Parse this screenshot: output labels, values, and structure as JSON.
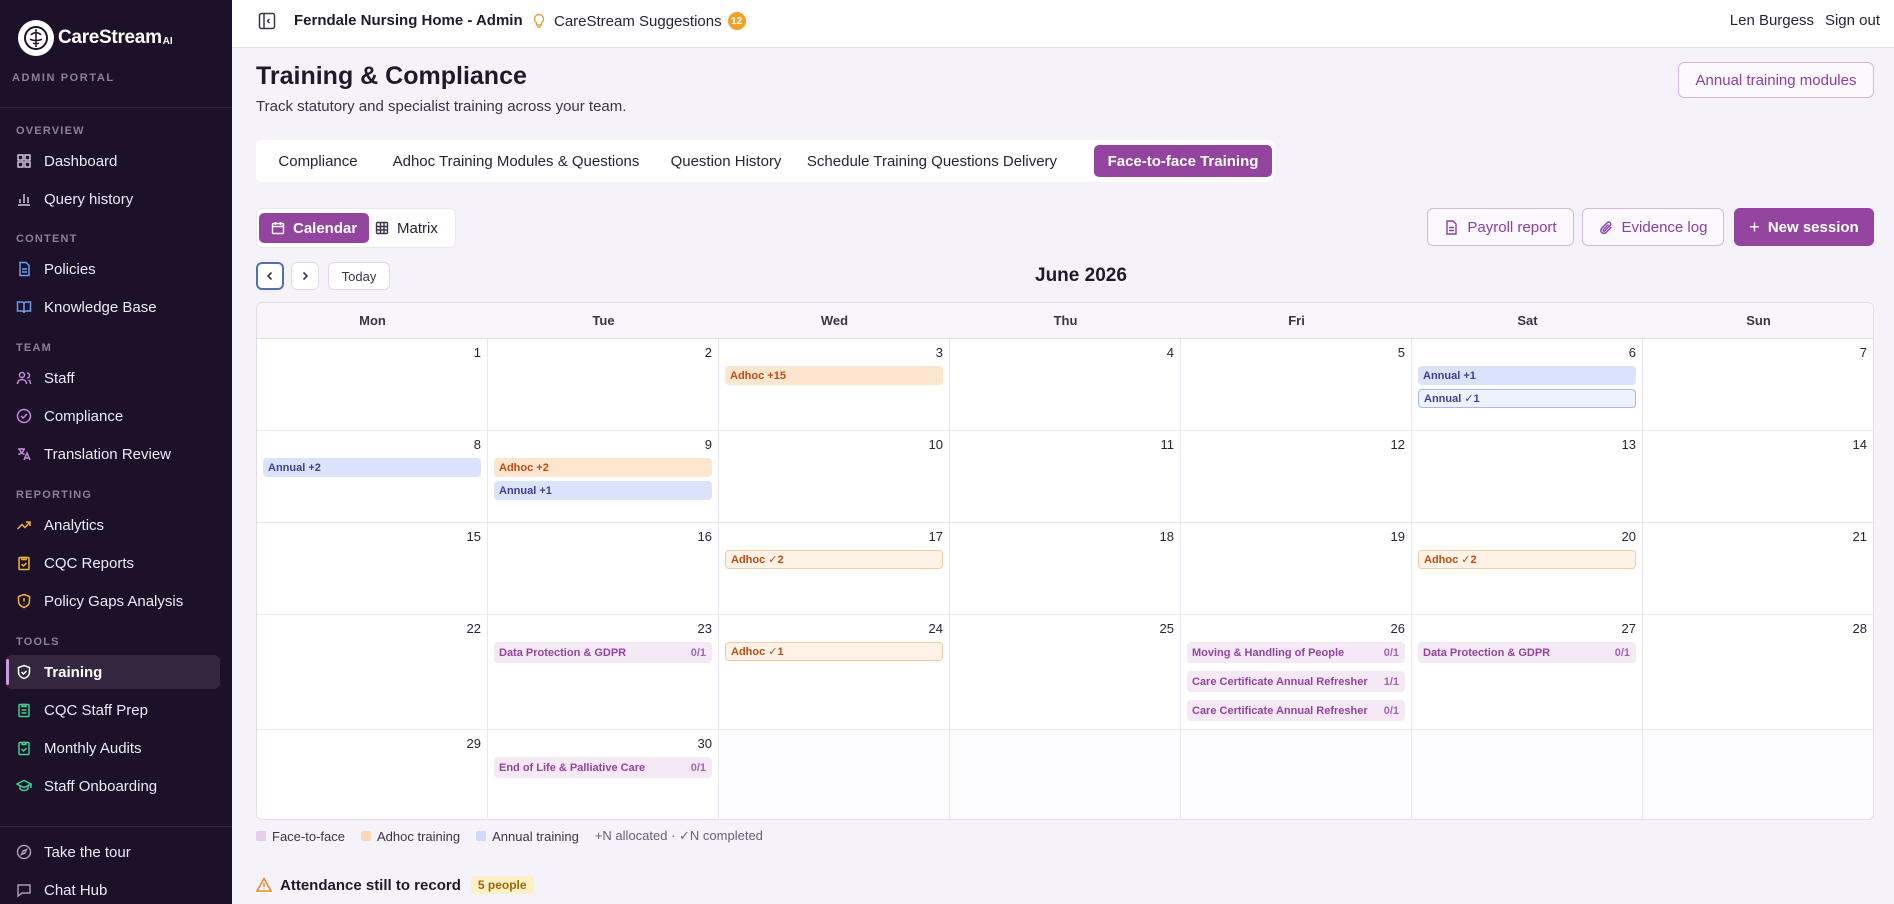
{
  "sidebar": {
    "brand": "CareStream",
    "brand_suffix": "AI",
    "portal_label": "ADMIN PORTAL",
    "sections": {
      "overview": "OVERVIEW",
      "content": "CONTENT",
      "team": "TEAM",
      "reporting": "REPORTING",
      "tools": "TOOLS"
    },
    "items": {
      "dashboard": "Dashboard",
      "query_history": "Query history",
      "policies": "Policies",
      "knowledge_base": "Knowledge Base",
      "staff": "Staff",
      "compliance": "Compliance",
      "translation_review": "Translation Review",
      "analytics": "Analytics",
      "cqc_reports": "CQC Reports",
      "policy_gaps": "Policy Gaps Analysis",
      "training": "Training",
      "cqc_staff_prep": "CQC Staff Prep",
      "monthly_audits": "Monthly Audits",
      "staff_onboarding": "Staff Onboarding",
      "take_tour": "Take the tour",
      "chat_hub": "Chat Hub"
    },
    "active_item": "training"
  },
  "topbar": {
    "org_title": "Ferndale Nursing Home - Admin",
    "suggestions_label": "CareStream Suggestions",
    "suggestions_count": "12",
    "user_name": "Len Burgess",
    "signout_label": "Sign out"
  },
  "page": {
    "title": "Training & Compliance",
    "subtitle": "Track statutory and specialist training across your team.",
    "annual_modules_button": "Annual training modules"
  },
  "tabs": [
    {
      "label": "Compliance",
      "active": false
    },
    {
      "label": "Adhoc Training Modules & Questions",
      "active": false
    },
    {
      "label": "Question History",
      "active": false
    },
    {
      "label": "Schedule Training Questions Delivery",
      "active": false
    },
    {
      "label": "Face-to-face Training",
      "active": true
    }
  ],
  "view_toggle": {
    "calendar": "Calendar",
    "matrix": "Matrix",
    "active": "calendar"
  },
  "actions": {
    "payroll": "Payroll report",
    "evidence": "Evidence log",
    "new_session": "New session"
  },
  "calendar": {
    "today_label": "Today",
    "month_title": "June 2026",
    "weekdays": [
      "Mon",
      "Tue",
      "Wed",
      "Thu",
      "Fri",
      "Sat",
      "Sun"
    ],
    "weeks": [
      [
        {
          "day": "1",
          "events": []
        },
        {
          "day": "2",
          "events": []
        },
        {
          "day": "3",
          "events": [
            {
              "type": "adhoc",
              "label": "Adhoc +15"
            }
          ]
        },
        {
          "day": "4",
          "events": []
        },
        {
          "day": "5",
          "events": []
        },
        {
          "day": "6",
          "events": [
            {
              "type": "annual",
              "label": "Annual +1"
            },
            {
              "type": "annual done",
              "label": "Annual ✓1"
            }
          ]
        },
        {
          "day": "7",
          "events": []
        }
      ],
      [
        {
          "day": "8",
          "events": [
            {
              "type": "annual",
              "label": "Annual +2"
            }
          ]
        },
        {
          "day": "9",
          "events": [
            {
              "type": "adhoc",
              "label": "Adhoc +2"
            },
            {
              "type": "annual",
              "label": "Annual +1"
            }
          ]
        },
        {
          "day": "10",
          "events": []
        },
        {
          "day": "11",
          "events": []
        },
        {
          "day": "12",
          "events": []
        },
        {
          "day": "13",
          "events": []
        },
        {
          "day": "14",
          "events": []
        }
      ],
      [
        {
          "day": "15",
          "events": []
        },
        {
          "day": "16",
          "events": []
        },
        {
          "day": "17",
          "events": [
            {
              "type": "adhoc done",
              "label": "Adhoc ✓2"
            }
          ]
        },
        {
          "day": "18",
          "events": []
        },
        {
          "day": "19",
          "events": []
        },
        {
          "day": "20",
          "events": [
            {
              "type": "adhoc done",
              "label": "Adhoc ✓2"
            }
          ]
        },
        {
          "day": "21",
          "events": []
        }
      ],
      [
        {
          "day": "22",
          "events": []
        },
        {
          "day": "23",
          "events": [
            {
              "type": "f2f",
              "label": "Data Protection & GDPR",
              "count": "0/1"
            }
          ]
        },
        {
          "day": "24",
          "events": [
            {
              "type": "adhoc done",
              "label": "Adhoc ✓1"
            }
          ]
        },
        {
          "day": "25",
          "events": []
        },
        {
          "day": "26",
          "events": [
            {
              "type": "f2f",
              "label": "Moving & Handling of People",
              "count": "0/1"
            },
            {
              "type": "f2f",
              "label": "Care Certificate Annual Refresher",
              "count": "1/1"
            },
            {
              "type": "f2f",
              "label": "Care Certificate Annual Refresher",
              "count": "0/1"
            }
          ]
        },
        {
          "day": "27",
          "events": [
            {
              "type": "f2f",
              "label": "Data Protection & GDPR",
              "count": "0/1"
            }
          ]
        },
        {
          "day": "28",
          "events": []
        }
      ],
      [
        {
          "day": "29",
          "events": []
        },
        {
          "day": "30",
          "events": [
            {
              "type": "f2f",
              "label": "End of Life & Palliative Care",
              "count": "0/1"
            }
          ]
        },
        {
          "day": "",
          "events": []
        },
        {
          "day": "",
          "events": []
        },
        {
          "day": "",
          "events": []
        },
        {
          "day": "",
          "events": []
        },
        {
          "day": "",
          "events": []
        }
      ]
    ]
  },
  "legend": {
    "f2f": "Face-to-face",
    "adhoc": "Adhoc training",
    "annual": "Annual training",
    "note": "+N allocated · ✓N completed",
    "colors": {
      "f2f": "#e7cdea",
      "adhoc": "#fcd9b4",
      "annual": "#cfd9f8"
    }
  },
  "attendance": {
    "title": "Attendance still to record",
    "badge": "5 people"
  }
}
